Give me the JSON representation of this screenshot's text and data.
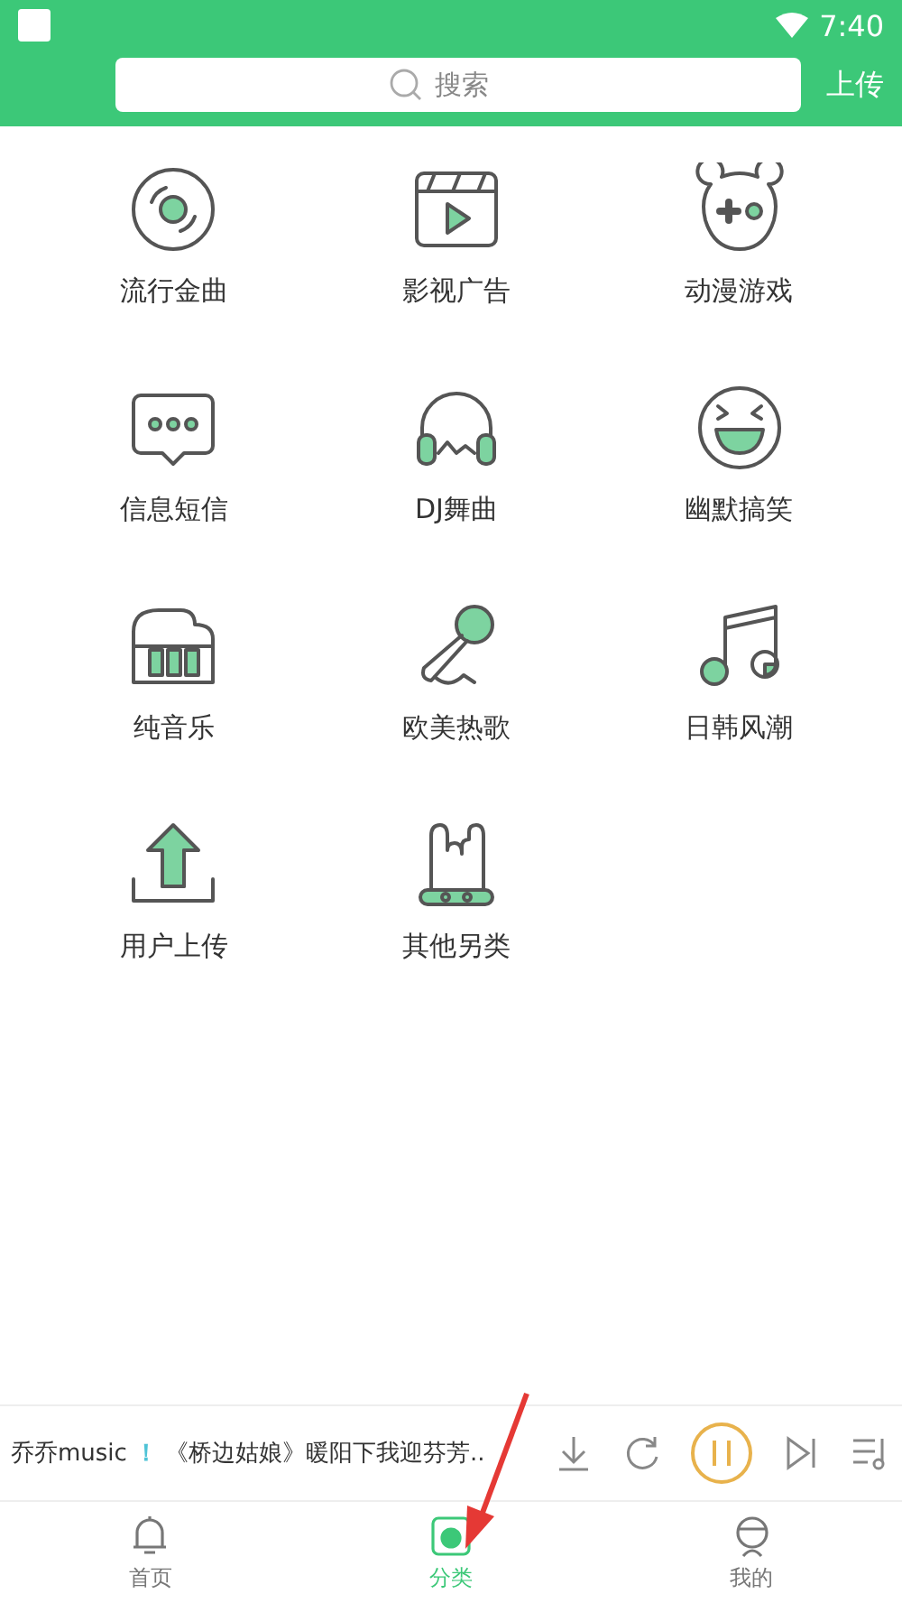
{
  "status_bar": {
    "time": "7:40"
  },
  "search": {
    "placeholder": "搜索"
  },
  "upload_button": "上传",
  "categories": [
    {
      "label": "流行金曲"
    },
    {
      "label": "影视广告"
    },
    {
      "label": "动漫游戏"
    },
    {
      "label": "信息短信"
    },
    {
      "label": "DJ舞曲"
    },
    {
      "label": "幽默搞笑"
    },
    {
      "label": "纯音乐"
    },
    {
      "label": "欧美热歌"
    },
    {
      "label": "日韩风潮"
    },
    {
      "label": "用户上传"
    },
    {
      "label": "其他另类"
    }
  ],
  "player": {
    "artist": "乔乔music",
    "separator": "！",
    "song": "《桥边姑娘》暖阳下我迎芬芳..",
    "playing": true
  },
  "tabs": [
    {
      "label": "首页",
      "selected": false
    },
    {
      "label": "分类",
      "selected": true
    },
    {
      "label": "我的",
      "selected": false
    }
  ]
}
